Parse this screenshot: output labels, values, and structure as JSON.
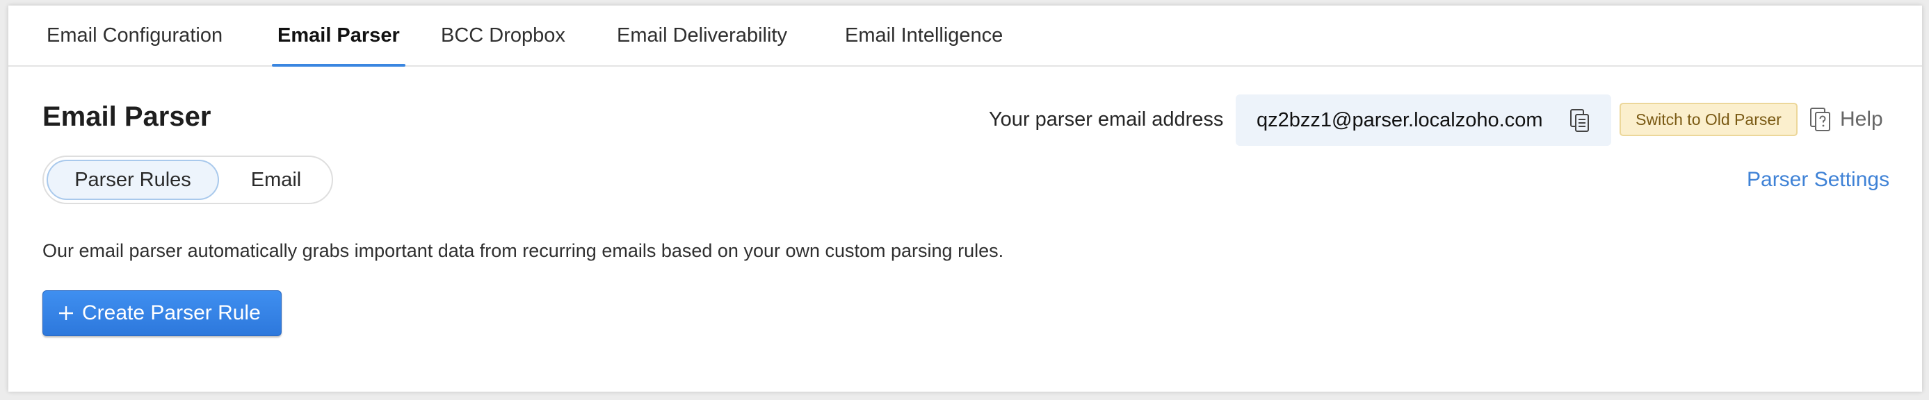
{
  "tabs": [
    {
      "label": "Email Configuration"
    },
    {
      "label": "Email Parser",
      "active": true
    },
    {
      "label": "BCC Dropbox"
    },
    {
      "label": "Email Deliverability"
    },
    {
      "label": "Email Intelligence"
    }
  ],
  "page": {
    "title": "Email Parser",
    "description": "Our email parser automatically grabs important data from recurring emails based on your own custom parsing rules."
  },
  "segmented": {
    "options": [
      {
        "label": "Parser Rules",
        "active": true
      },
      {
        "label": "Email"
      }
    ]
  },
  "parser_address": {
    "label": "Your parser email address",
    "value": "qz2bzz1@parser.localzoho.com",
    "copy_icon": "copy-icon"
  },
  "actions": {
    "switch_old_parser": "Switch to Old Parser",
    "help": "Help",
    "help_icon": "help-icon",
    "parser_settings": "Parser Settings",
    "create_rule": "Create Parser Rule",
    "create_icon": "plus-icon"
  },
  "colors": {
    "accent": "#3a86e0",
    "link": "#3f82d6",
    "primary_button": "#3384e6",
    "address_bg": "#edf3fa",
    "old_parser_bg": "#fbefcd"
  }
}
